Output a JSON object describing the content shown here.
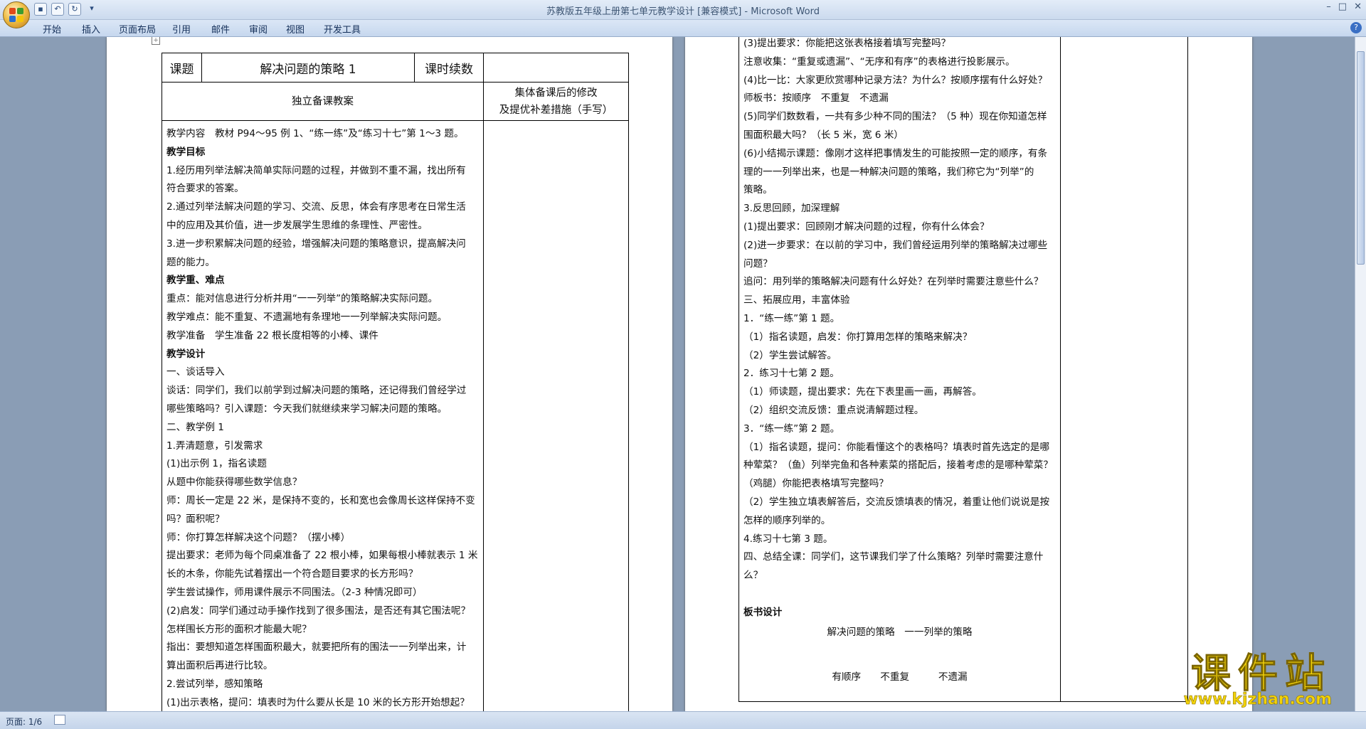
{
  "window": {
    "title": "苏教版五年级上册第七单元教学设计 [兼容模式] - Microsoft Word"
  },
  "menu": [
    "开始",
    "插入",
    "页面布局",
    "引用",
    "邮件",
    "审阅",
    "视图",
    "开发工具"
  ],
  "status": {
    "page": "页面: 1/6"
  },
  "table1": {
    "topic_label": "课题",
    "topic": "解决问题的策略 1",
    "hours_label": "课时续数",
    "prep_label": "独立备课教案",
    "notes_label": "集体备课后的修改",
    "notes_label2": "及提优补差措施（手写）"
  },
  "page1_lines": [
    "教学内容　教材 P94～95 例 1、“练一练”及“练习十七”第 1～3 题。",
    "教学目标",
    "1.经历用列举法解决简单实际问题的过程，并做到不重不漏，找出所有",
    "符合要求的答案。",
    "2.通过列举法解决问题的学习、交流、反思，体会有序思考在日常生活",
    "中的应用及其价值，进一步发展学生思维的条理性、严密性。",
    "3.进一步积累解决问题的经验，增强解决问题的策略意识，提高解决问",
    "题的能力。",
    "教学重、难点",
    "重点：能对信息进行分析并用“一一列举”的策略解决实际问题。",
    "教学难点：能不重复、不遗漏地有条理地一一列举解决实际问题。",
    "教学准备　学生准备 22 根长度相等的小棒、课件",
    "教学设计",
    "一、谈话导入",
    "谈话：同学们，我们以前学到过解决问题的策略，还记得我们曾经学过",
    "哪些策略吗？引入课题：今天我们就继续来学习解决问题的策略。",
    "二、教学例 1",
    "1.弄清题意，引发需求",
    "(1)出示例 1，指名读题",
    "从题中你能获得哪些数学信息？",
    "师：周长一定是 22 米，是保持不变的，长和宽也会像周长这样保持不变",
    "吗？面积呢？",
    "师：你打算怎样解决这个问题？（摆小棒）",
    "提出要求：老师为每个同桌准备了 22 根小棒，如果每根小棒就表示 1 米",
    "长的木条，你能先试着摆出一个符合题目要求的长方形吗？",
    "学生尝试操作，师用课件展示不同围法。（2-3 种情况即可）",
    "(2)启发：同学们通过动手操作找到了很多围法，是否还有其它围法呢？",
    "怎样围长方形的面积才能最大呢？",
    "指出：要想知道怎样围面积最大，就要把所有的围法一一列举出来，计",
    "算出面积后再进行比较。",
    "2.尝试列举，感知策略",
    "(1)出示表格，提问：填表时为什么要从长是 10 米的长方形开始想起？"
  ],
  "page2_lines": [
    "(3)提出要求：你能把这张表格接着填写完整吗？",
    "注意收集：“重复或遗漏”、“无序和有序”的表格进行投影展示。",
    "(4)比一比：大家更欣赏哪种记录方法？为什么？按顺序摆有什么好处？",
    "师板书：按顺序　不重复　不遗漏",
    "(5)同学们数数看，一共有多少种不同的围法？（5 种）现在你知道怎样",
    "围面积最大吗？（长 5 米，宽 6 米）",
    "(6)小结揭示课题：像刚才这样把事情发生的可能按照一定的顺序，有条",
    "理的一一列举出来，也是一种解决问题的策略，我们称它为“列举”的",
    "策略。",
    "3.反思回顾，加深理解",
    "(1)提出要求：回顾刚才解决问题的过程，你有什么体会？",
    "(2)进一步要求：在以前的学习中，我们曾经运用列举的策略解决过哪些",
    "问题？",
    "追问：用列举的策略解决问题有什么好处？在列举时需要注意些什么？",
    "三、拓展应用，丰富体验",
    "1．“练一练”第 1 题。",
    "（1）指名读题，启发：你打算用怎样的策略来解决？",
    "（2）学生尝试解答。",
    "2．练习十七第 2 题。",
    "（1）师读题，提出要求：先在下表里画一画，再解答。",
    "（2）组织交流反馈：重点说清解题过程。",
    "3．“练一练”第 2 题。",
    "（1）指名读题，提问：你能看懂这个的表格吗？填表时首先选定的是哪",
    "种荤菜？（鱼）列举完鱼和各种素菜的搭配后，接着考虑的是哪种荤菜？",
    "（鸡腿）你能把表格填写完整吗？",
    "（2）学生独立填表解答后，交流反馈填表的情况，着重让他们说说是按",
    "怎样的顺序列举的。",
    "4.练习十七第 3 题。",
    "四、总结全课：同学们，这节课我们学了什么策略？列举时需要注意什",
    "么？",
    "",
    "板书设计"
  ],
  "board": {
    "title": "解决问题的策略　一一列举的策略",
    "items": "有顺序　　不重复　　　不遗漏"
  },
  "logo": {
    "cn": "课件站",
    "url": "www.kjzhan.com"
  }
}
